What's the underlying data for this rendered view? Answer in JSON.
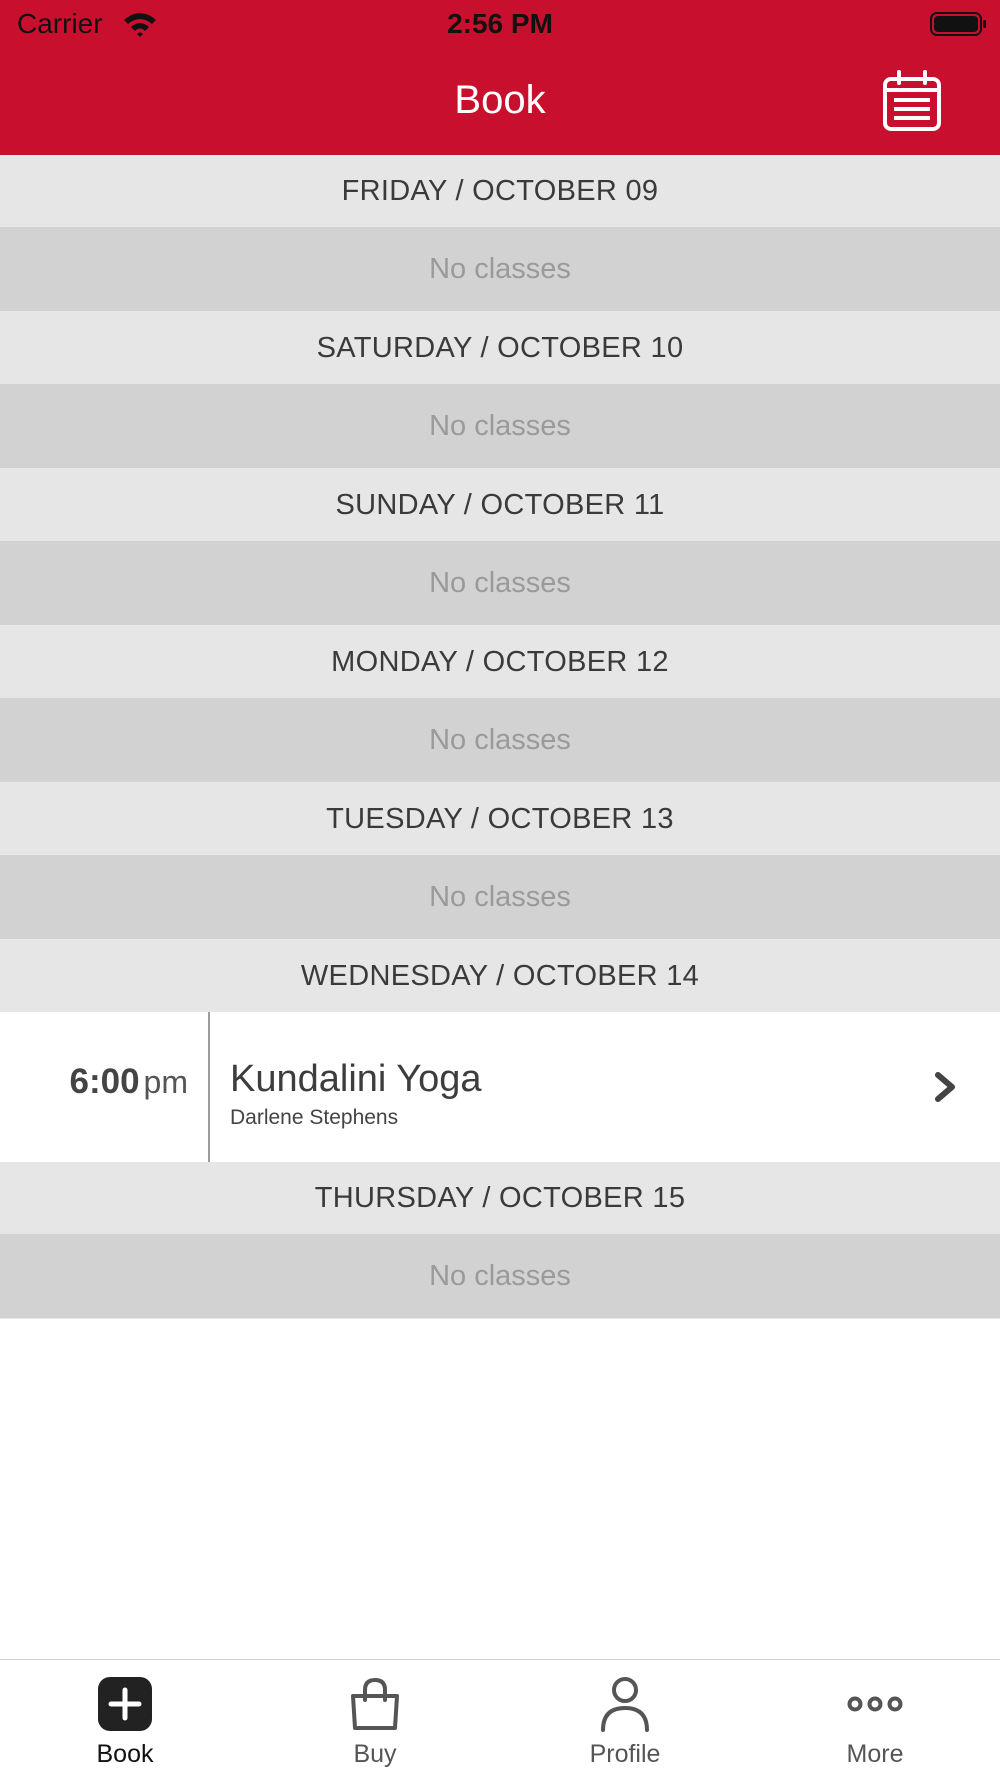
{
  "status_bar": {
    "carrier": "Carrier",
    "time": "2:56 PM"
  },
  "header": {
    "title": "Book",
    "calendar_icon": "calendar-icon"
  },
  "days": [
    {
      "heading": "FRIDAY / OCTOBER 09",
      "empty_text": "No classes"
    },
    {
      "heading": "SATURDAY / OCTOBER 10",
      "empty_text": "No classes"
    },
    {
      "heading": "SUNDAY / OCTOBER 11",
      "empty_text": "No classes"
    },
    {
      "heading": "MONDAY / OCTOBER 12",
      "empty_text": "No classes"
    },
    {
      "heading": "TUESDAY / OCTOBER 13",
      "empty_text": "No classes"
    },
    {
      "heading": "WEDNESDAY / OCTOBER 14",
      "class": {
        "time": "6:00",
        "ampm": "pm",
        "name": "Kundalini Yoga",
        "instructor": "Darlene Stephens"
      }
    },
    {
      "heading": "THURSDAY / OCTOBER 15",
      "empty_text": "No classes"
    }
  ],
  "tabbar": {
    "tabs": [
      {
        "label": "Book",
        "icon": "plus-square-icon",
        "active": true
      },
      {
        "label": "Buy",
        "icon": "shopping-bag-icon",
        "active": false
      },
      {
        "label": "Profile",
        "icon": "person-icon",
        "active": false
      },
      {
        "label": "More",
        "icon": "more-dots-icon",
        "active": false
      }
    ]
  },
  "colors": {
    "brand": "#c8102e",
    "day_header_bg": "#e6e6e6",
    "empty_bg": "#d2d2d2"
  }
}
